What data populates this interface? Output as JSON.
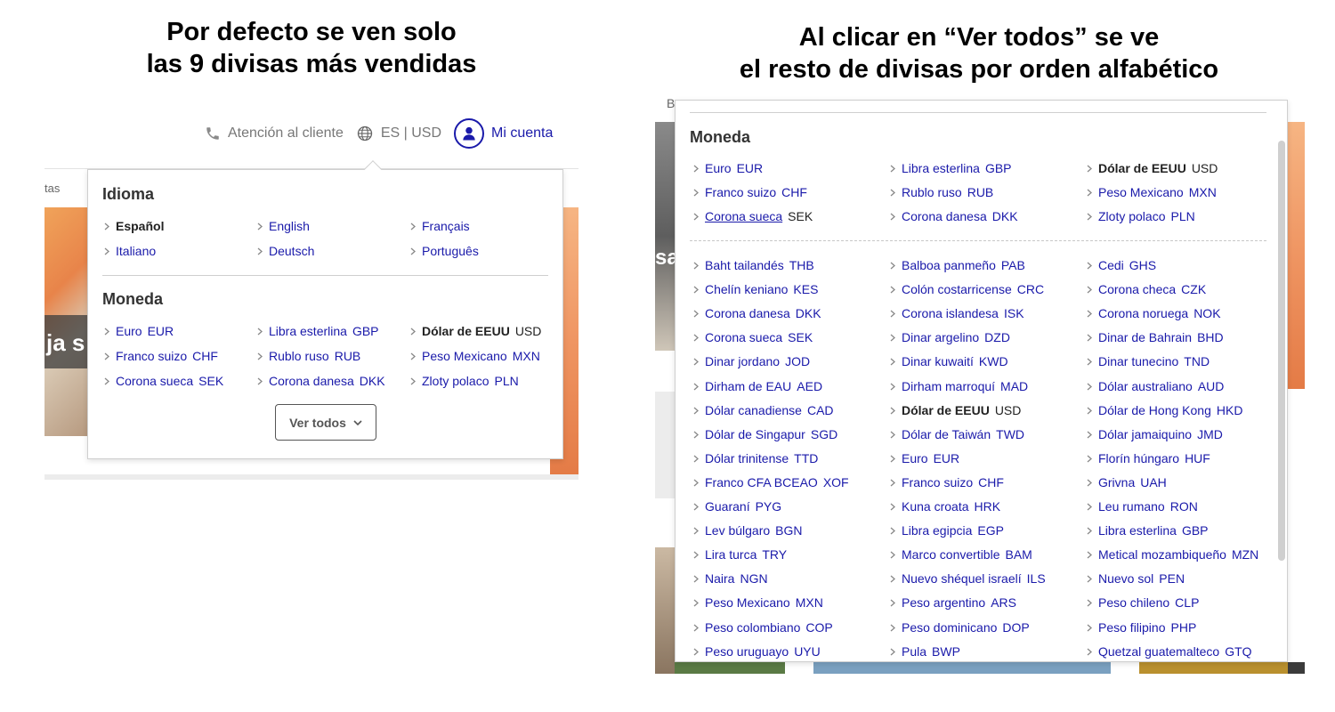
{
  "left": {
    "heading": [
      "Por defecto se ven solo",
      "las 9 divisas más vendidas"
    ],
    "topbar": {
      "support": "Atención al cliente",
      "locale": "ES | USD",
      "account": "Mi cuenta"
    },
    "bg_text": {
      "partial_tab": "tas",
      "partial_headline": "ja s"
    },
    "idioma_title": "Idioma",
    "languages": [
      {
        "name": "Español",
        "bold": true
      },
      {
        "name": "English"
      },
      {
        "name": "Français"
      },
      {
        "name": "Italiano"
      },
      {
        "name": "Deutsch"
      },
      {
        "name": "Português"
      }
    ],
    "moneda_title": "Moneda",
    "currencies": [
      {
        "name": "Euro",
        "code": "EUR"
      },
      {
        "name": "Libra esterlina",
        "code": "GBP"
      },
      {
        "name": "Dólar de EEUU",
        "code": "USD",
        "bold": true
      },
      {
        "name": "Franco suizo",
        "code": "CHF"
      },
      {
        "name": "Rublo ruso",
        "code": "RUB"
      },
      {
        "name": "Peso Mexicano",
        "code": "MXN"
      },
      {
        "name": "Corona sueca",
        "code": "SEK"
      },
      {
        "name": "Corona danesa",
        "code": "DKK"
      },
      {
        "name": "Zloty polaco",
        "code": "PLN"
      }
    ],
    "ver_todos": "Ver todos"
  },
  "right": {
    "heading": [
      "Al clicar en “Ver todos” se ve",
      "el resto de divisas por orden alfabético"
    ],
    "bg_text": {
      "partial_b": "B",
      "partial_sa": "sa"
    },
    "moneda_title": "Moneda",
    "top_currencies": [
      {
        "name": "Euro",
        "code": "EUR"
      },
      {
        "name": "Libra esterlina",
        "code": "GBP"
      },
      {
        "name": "Dólar de EEUU",
        "code": "USD",
        "bold": true
      },
      {
        "name": "Franco suizo",
        "code": "CHF"
      },
      {
        "name": "Rublo ruso",
        "code": "RUB"
      },
      {
        "name": "Peso Mexicano",
        "code": "MXN"
      },
      {
        "name": "Corona sueca",
        "code": "SEK",
        "underline": true
      },
      {
        "name": "Corona danesa",
        "code": "DKK"
      },
      {
        "name": "Zloty polaco",
        "code": "PLN"
      }
    ],
    "all_currencies": [
      {
        "name": "Baht tailandés",
        "code": "THB"
      },
      {
        "name": "Balboa panmeño",
        "code": "PAB"
      },
      {
        "name": "Cedi",
        "code": "GHS"
      },
      {
        "name": "Chelín keniano",
        "code": "KES"
      },
      {
        "name": "Colón costarricense",
        "code": "CRC"
      },
      {
        "name": "Corona checa",
        "code": "CZK"
      },
      {
        "name": "Corona danesa",
        "code": "DKK"
      },
      {
        "name": "Corona islandesa",
        "code": "ISK"
      },
      {
        "name": "Corona noruega",
        "code": "NOK"
      },
      {
        "name": "Corona sueca",
        "code": "SEK"
      },
      {
        "name": "Dinar argelino",
        "code": "DZD"
      },
      {
        "name": "Dinar de Bahrain",
        "code": "BHD"
      },
      {
        "name": "Dinar jordano",
        "code": "JOD"
      },
      {
        "name": "Dinar kuwaití",
        "code": "KWD"
      },
      {
        "name": "Dinar tunecino",
        "code": "TND"
      },
      {
        "name": "Dirham de EAU",
        "code": "AED"
      },
      {
        "name": "Dirham marroquí",
        "code": "MAD"
      },
      {
        "name": "Dólar australiano",
        "code": "AUD"
      },
      {
        "name": "Dólar canadiense",
        "code": "CAD"
      },
      {
        "name": "Dólar de EEUU",
        "code": "USD",
        "bold": true
      },
      {
        "name": "Dólar de Hong Kong",
        "code": "HKD"
      },
      {
        "name": "Dólar de Singapur",
        "code": "SGD"
      },
      {
        "name": "Dólar de Taiwán",
        "code": "TWD"
      },
      {
        "name": "Dólar jamaiquino",
        "code": "JMD"
      },
      {
        "name": "Dólar trinitense",
        "code": "TTD"
      },
      {
        "name": "Euro",
        "code": "EUR"
      },
      {
        "name": "Florín húngaro",
        "code": "HUF"
      },
      {
        "name": "Franco CFA BCEAO",
        "code": "XOF"
      },
      {
        "name": "Franco suizo",
        "code": "CHF"
      },
      {
        "name": "Grivna",
        "code": "UAH"
      },
      {
        "name": "Guaraní",
        "code": "PYG"
      },
      {
        "name": "Kuna croata",
        "code": "HRK"
      },
      {
        "name": "Leu rumano",
        "code": "RON"
      },
      {
        "name": "Lev búlgaro",
        "code": "BGN"
      },
      {
        "name": "Libra egipcia",
        "code": "EGP"
      },
      {
        "name": "Libra esterlina",
        "code": "GBP"
      },
      {
        "name": "Lira turca",
        "code": "TRY"
      },
      {
        "name": "Marco convertible",
        "code": "BAM"
      },
      {
        "name": "Metical mozambiqueño",
        "code": "MZN"
      },
      {
        "name": "Naira",
        "code": "NGN"
      },
      {
        "name": "Nuevo shéquel israelí",
        "code": "ILS"
      },
      {
        "name": "Nuevo sol",
        "code": "PEN"
      },
      {
        "name": "Peso Mexicano",
        "code": "MXN"
      },
      {
        "name": "Peso argentino",
        "code": "ARS"
      },
      {
        "name": "Peso chileno",
        "code": "CLP"
      },
      {
        "name": "Peso colombiano",
        "code": "COP"
      },
      {
        "name": "Peso dominicano",
        "code": "DOP"
      },
      {
        "name": "Peso filipino",
        "code": "PHP"
      },
      {
        "name": "Peso uruguayo",
        "code": "UYU"
      },
      {
        "name": "Pula",
        "code": "BWP"
      },
      {
        "name": "Quetzal guatemalteco",
        "code": "GTQ"
      }
    ]
  },
  "colors": {
    "link": "#1a1aaa",
    "heading": "#000000",
    "muted": "#777777"
  },
  "icons": [
    "phone-icon",
    "globe-icon",
    "user-icon",
    "chevron-right-icon",
    "chevron-down-icon"
  ]
}
